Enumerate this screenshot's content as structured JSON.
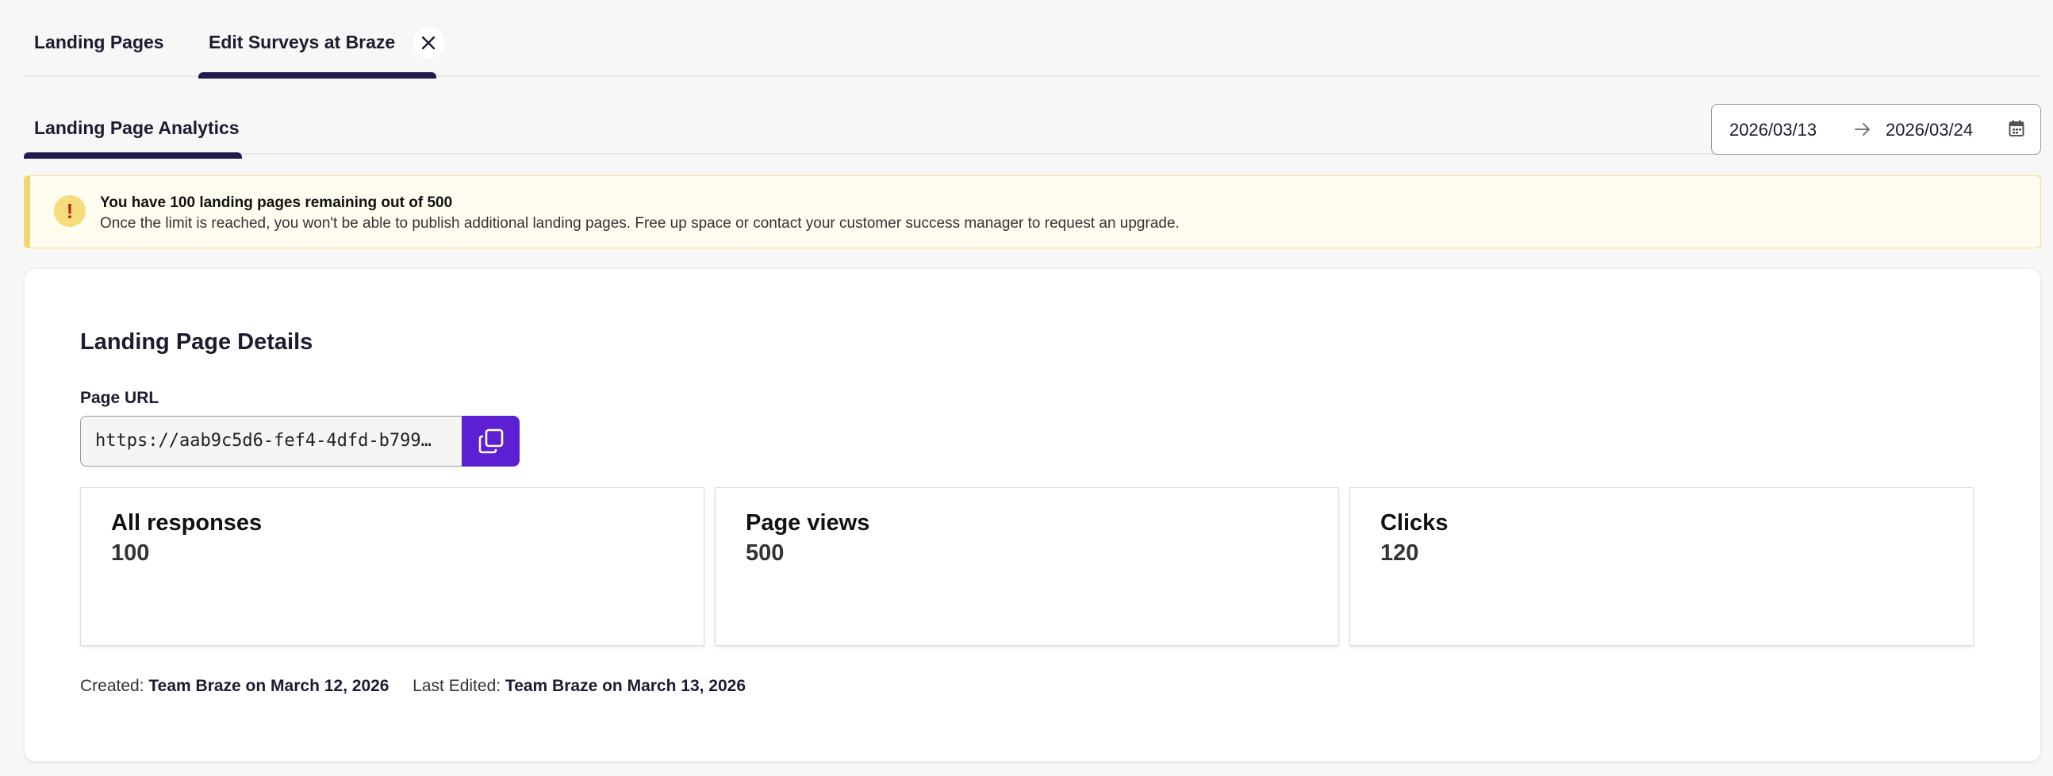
{
  "tabs": {
    "landing_pages": "Landing Pages",
    "edit_surveys": "Edit Surveys at Braze"
  },
  "icons": {
    "close": "close-icon",
    "arrow": "arrow-right-icon",
    "calendar": "calendar-icon",
    "warning": "exclamation-icon",
    "copy": "copy-icon"
  },
  "subnav": {
    "analytics_tab": "Landing Page Analytics"
  },
  "date_range": {
    "start": "2026/03/13",
    "end": "2026/03/24"
  },
  "alert": {
    "symbol": "!",
    "title": "You have 100 landing pages remaining out of 500",
    "body": "Once the limit is reached, you won't be able to publish additional landing pages. Free up space or contact your customer success manager to request an upgrade."
  },
  "details": {
    "title": "Landing Page Details",
    "url_label": "Page URL",
    "url_value": "https://aab9c5d6-fef4-4dfd-b799…"
  },
  "stats": [
    {
      "label": "All responses",
      "value": "100"
    },
    {
      "label": "Page views",
      "value": "500"
    },
    {
      "label": "Clicks",
      "value": "120"
    }
  ],
  "meta": {
    "created_label": "Created:",
    "created_value": "Team Braze on March 12, 2026",
    "edited_label": "Last Edited:",
    "edited_value": "Team Braze on March 13, 2026"
  },
  "colors": {
    "accent": "#5d1fd3",
    "tab_underline": "#23194e",
    "alert_bg": "#fffcf0",
    "alert_border": "#f3d572"
  }
}
